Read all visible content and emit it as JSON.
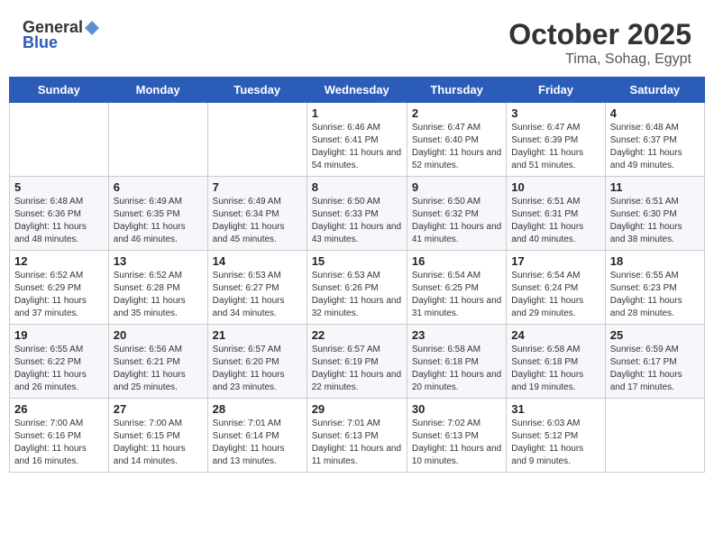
{
  "header": {
    "logo_general": "General",
    "logo_blue": "Blue",
    "month_title": "October 2025",
    "location": "Tima, Sohag, Egypt"
  },
  "weekdays": [
    "Sunday",
    "Monday",
    "Tuesday",
    "Wednesday",
    "Thursday",
    "Friday",
    "Saturday"
  ],
  "weeks": [
    [
      {
        "day": "",
        "sunrise": "",
        "sunset": "",
        "daylight": ""
      },
      {
        "day": "",
        "sunrise": "",
        "sunset": "",
        "daylight": ""
      },
      {
        "day": "",
        "sunrise": "",
        "sunset": "",
        "daylight": ""
      },
      {
        "day": "1",
        "sunrise": "Sunrise: 6:46 AM",
        "sunset": "Sunset: 6:41 PM",
        "daylight": "Daylight: 11 hours and 54 minutes."
      },
      {
        "day": "2",
        "sunrise": "Sunrise: 6:47 AM",
        "sunset": "Sunset: 6:40 PM",
        "daylight": "Daylight: 11 hours and 52 minutes."
      },
      {
        "day": "3",
        "sunrise": "Sunrise: 6:47 AM",
        "sunset": "Sunset: 6:39 PM",
        "daylight": "Daylight: 11 hours and 51 minutes."
      },
      {
        "day": "4",
        "sunrise": "Sunrise: 6:48 AM",
        "sunset": "Sunset: 6:37 PM",
        "daylight": "Daylight: 11 hours and 49 minutes."
      }
    ],
    [
      {
        "day": "5",
        "sunrise": "Sunrise: 6:48 AM",
        "sunset": "Sunset: 6:36 PM",
        "daylight": "Daylight: 11 hours and 48 minutes."
      },
      {
        "day": "6",
        "sunrise": "Sunrise: 6:49 AM",
        "sunset": "Sunset: 6:35 PM",
        "daylight": "Daylight: 11 hours and 46 minutes."
      },
      {
        "day": "7",
        "sunrise": "Sunrise: 6:49 AM",
        "sunset": "Sunset: 6:34 PM",
        "daylight": "Daylight: 11 hours and 45 minutes."
      },
      {
        "day": "8",
        "sunrise": "Sunrise: 6:50 AM",
        "sunset": "Sunset: 6:33 PM",
        "daylight": "Daylight: 11 hours and 43 minutes."
      },
      {
        "day": "9",
        "sunrise": "Sunrise: 6:50 AM",
        "sunset": "Sunset: 6:32 PM",
        "daylight": "Daylight: 11 hours and 41 minutes."
      },
      {
        "day": "10",
        "sunrise": "Sunrise: 6:51 AM",
        "sunset": "Sunset: 6:31 PM",
        "daylight": "Daylight: 11 hours and 40 minutes."
      },
      {
        "day": "11",
        "sunrise": "Sunrise: 6:51 AM",
        "sunset": "Sunset: 6:30 PM",
        "daylight": "Daylight: 11 hours and 38 minutes."
      }
    ],
    [
      {
        "day": "12",
        "sunrise": "Sunrise: 6:52 AM",
        "sunset": "Sunset: 6:29 PM",
        "daylight": "Daylight: 11 hours and 37 minutes."
      },
      {
        "day": "13",
        "sunrise": "Sunrise: 6:52 AM",
        "sunset": "Sunset: 6:28 PM",
        "daylight": "Daylight: 11 hours and 35 minutes."
      },
      {
        "day": "14",
        "sunrise": "Sunrise: 6:53 AM",
        "sunset": "Sunset: 6:27 PM",
        "daylight": "Daylight: 11 hours and 34 minutes."
      },
      {
        "day": "15",
        "sunrise": "Sunrise: 6:53 AM",
        "sunset": "Sunset: 6:26 PM",
        "daylight": "Daylight: 11 hours and 32 minutes."
      },
      {
        "day": "16",
        "sunrise": "Sunrise: 6:54 AM",
        "sunset": "Sunset: 6:25 PM",
        "daylight": "Daylight: 11 hours and 31 minutes."
      },
      {
        "day": "17",
        "sunrise": "Sunrise: 6:54 AM",
        "sunset": "Sunset: 6:24 PM",
        "daylight": "Daylight: 11 hours and 29 minutes."
      },
      {
        "day": "18",
        "sunrise": "Sunrise: 6:55 AM",
        "sunset": "Sunset: 6:23 PM",
        "daylight": "Daylight: 11 hours and 28 minutes."
      }
    ],
    [
      {
        "day": "19",
        "sunrise": "Sunrise: 6:55 AM",
        "sunset": "Sunset: 6:22 PM",
        "daylight": "Daylight: 11 hours and 26 minutes."
      },
      {
        "day": "20",
        "sunrise": "Sunrise: 6:56 AM",
        "sunset": "Sunset: 6:21 PM",
        "daylight": "Daylight: 11 hours and 25 minutes."
      },
      {
        "day": "21",
        "sunrise": "Sunrise: 6:57 AM",
        "sunset": "Sunset: 6:20 PM",
        "daylight": "Daylight: 11 hours and 23 minutes."
      },
      {
        "day": "22",
        "sunrise": "Sunrise: 6:57 AM",
        "sunset": "Sunset: 6:19 PM",
        "daylight": "Daylight: 11 hours and 22 minutes."
      },
      {
        "day": "23",
        "sunrise": "Sunrise: 6:58 AM",
        "sunset": "Sunset: 6:18 PM",
        "daylight": "Daylight: 11 hours and 20 minutes."
      },
      {
        "day": "24",
        "sunrise": "Sunrise: 6:58 AM",
        "sunset": "Sunset: 6:18 PM",
        "daylight": "Daylight: 11 hours and 19 minutes."
      },
      {
        "day": "25",
        "sunrise": "Sunrise: 6:59 AM",
        "sunset": "Sunset: 6:17 PM",
        "daylight": "Daylight: 11 hours and 17 minutes."
      }
    ],
    [
      {
        "day": "26",
        "sunrise": "Sunrise: 7:00 AM",
        "sunset": "Sunset: 6:16 PM",
        "daylight": "Daylight: 11 hours and 16 minutes."
      },
      {
        "day": "27",
        "sunrise": "Sunrise: 7:00 AM",
        "sunset": "Sunset: 6:15 PM",
        "daylight": "Daylight: 11 hours and 14 minutes."
      },
      {
        "day": "28",
        "sunrise": "Sunrise: 7:01 AM",
        "sunset": "Sunset: 6:14 PM",
        "daylight": "Daylight: 11 hours and 13 minutes."
      },
      {
        "day": "29",
        "sunrise": "Sunrise: 7:01 AM",
        "sunset": "Sunset: 6:13 PM",
        "daylight": "Daylight: 11 hours and 11 minutes."
      },
      {
        "day": "30",
        "sunrise": "Sunrise: 7:02 AM",
        "sunset": "Sunset: 6:13 PM",
        "daylight": "Daylight: 11 hours and 10 minutes."
      },
      {
        "day": "31",
        "sunrise": "Sunrise: 6:03 AM",
        "sunset": "Sunset: 5:12 PM",
        "daylight": "Daylight: 11 hours and 9 minutes."
      },
      {
        "day": "",
        "sunrise": "",
        "sunset": "",
        "daylight": ""
      }
    ]
  ]
}
